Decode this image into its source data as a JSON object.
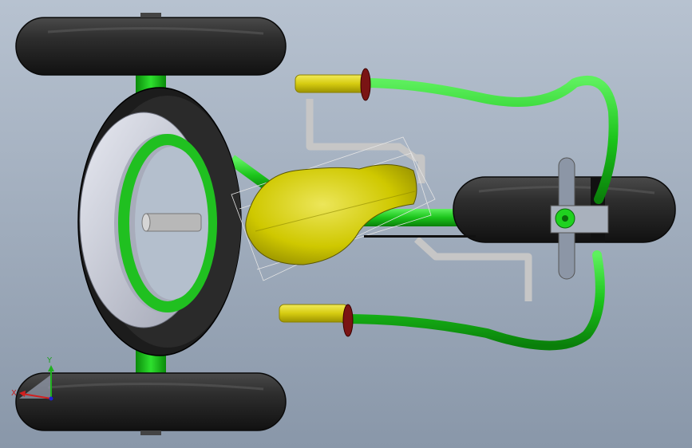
{
  "viewport": {
    "background_top": "#b4bfcd",
    "background_bottom": "#8a98aa"
  },
  "model": {
    "frame_color": "#19c519",
    "tire_color": "#2b2b2b",
    "rim_color": "#c9ccd8",
    "seat_color": "#d4d000",
    "grip_color": "#e2d61f",
    "hardware_color": "#c8c8c8",
    "grip_end_color": "#7a1414"
  },
  "triad": {
    "x_label": "X",
    "y_label": "Y",
    "x_color": "#d02020",
    "y_color": "#20b020",
    "z_color": "#2020d0"
  }
}
